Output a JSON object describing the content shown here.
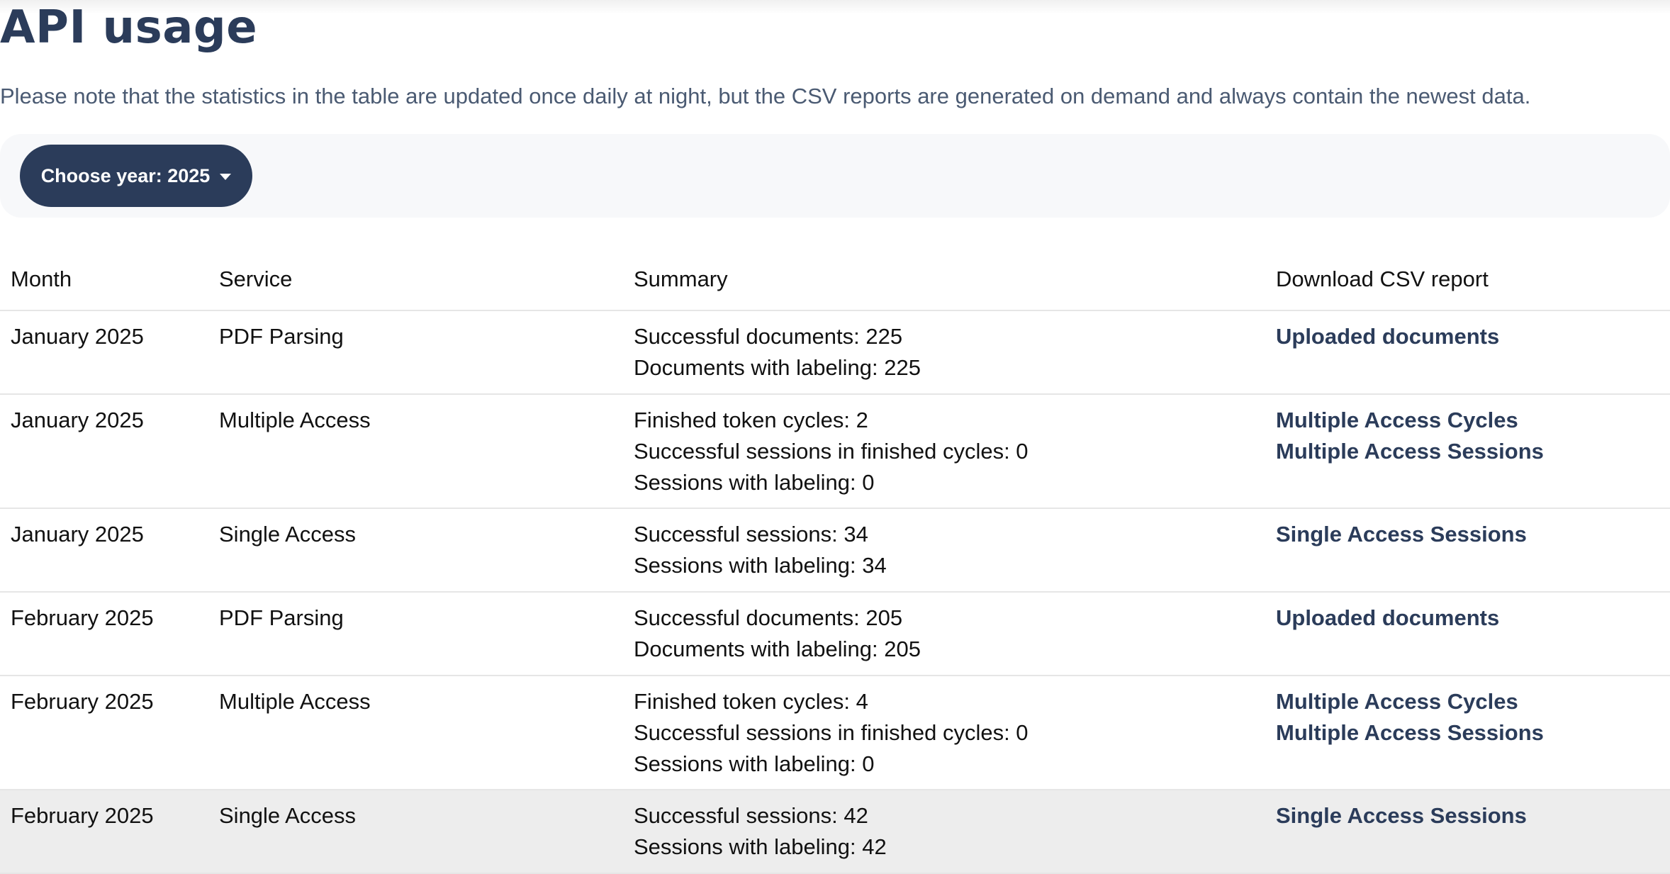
{
  "page": {
    "title": "API usage",
    "note": "Please note that the statistics in the table are updated once daily at night, but the CSV reports are generated on demand and always contain the newest data."
  },
  "filter": {
    "year_button_label": "Choose year: 2025"
  },
  "colors": {
    "primary": "#2b3c5a",
    "highlight_row": "#ededed",
    "filter_bar_bg": "#f7f8fa"
  },
  "table": {
    "headers": [
      "Month",
      "Service",
      "Summary",
      "Download CSV report"
    ],
    "rows": [
      {
        "month": "January 2025",
        "service": "PDF Parsing",
        "summary": [
          "Successful documents: 225",
          "Documents with labeling: 225"
        ],
        "links": [
          "Uploaded documents"
        ]
      },
      {
        "month": "January 2025",
        "service": "Multiple Access",
        "summary": [
          "Finished token cycles: 2",
          "Successful sessions in finished cycles: 0",
          "Sessions with labeling: 0"
        ],
        "links": [
          "Multiple Access Cycles",
          "Multiple Access Sessions"
        ]
      },
      {
        "month": "January 2025",
        "service": "Single Access",
        "summary": [
          "Successful sessions: 34",
          "Sessions with labeling: 34"
        ],
        "links": [
          "Single Access Sessions"
        ]
      },
      {
        "month": "February 2025",
        "service": "PDF Parsing",
        "summary": [
          "Successful documents: 205",
          "Documents with labeling: 205"
        ],
        "links": [
          "Uploaded documents"
        ]
      },
      {
        "month": "February 2025",
        "service": "Multiple Access",
        "summary": [
          "Finished token cycles: 4",
          "Successful sessions in finished cycles: 0",
          "Sessions with labeling: 0"
        ],
        "links": [
          "Multiple Access Cycles",
          "Multiple Access Sessions"
        ]
      },
      {
        "month": "February 2025",
        "service": "Single Access",
        "summary": [
          "Successful sessions: 42",
          "Sessions with labeling: 42"
        ],
        "links": [
          "Single Access Sessions"
        ]
      }
    ]
  }
}
